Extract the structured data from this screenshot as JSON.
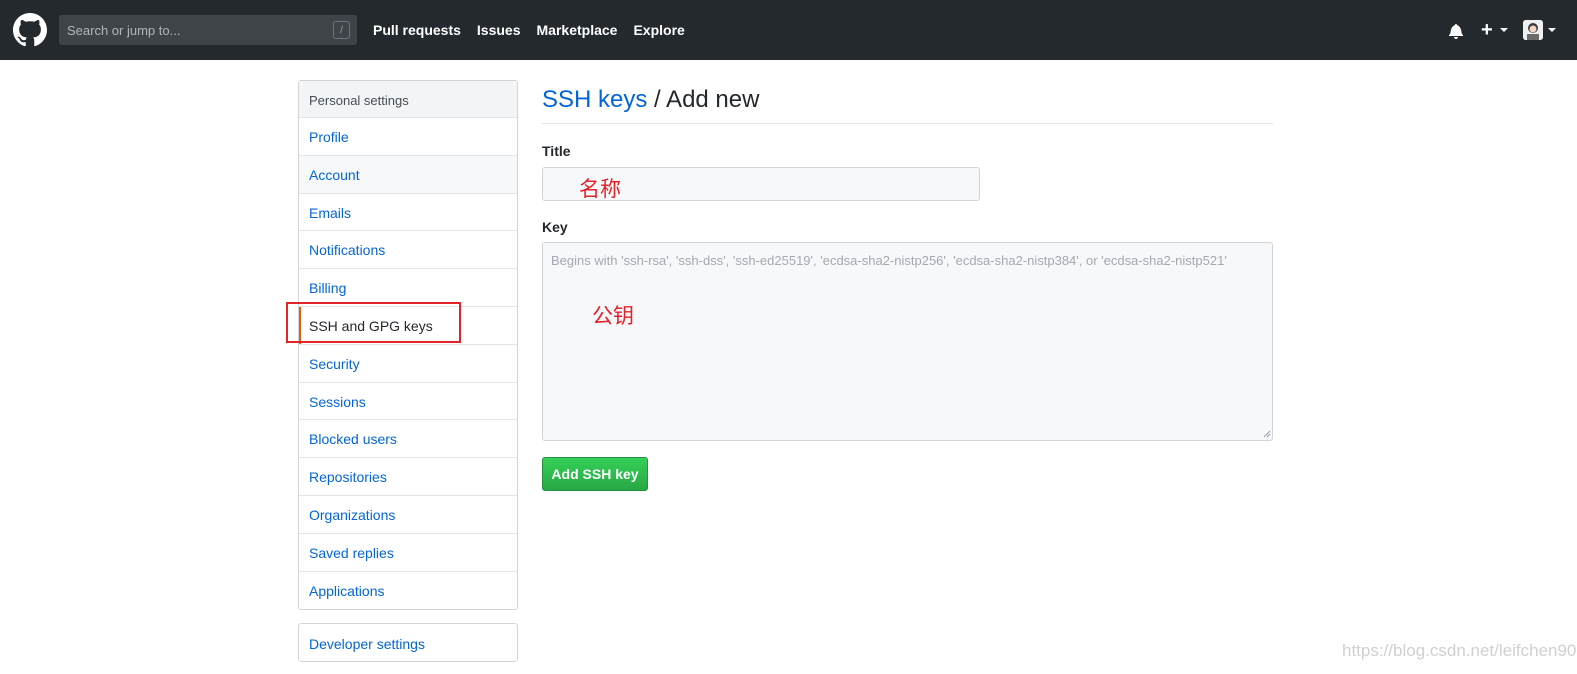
{
  "header": {
    "search_placeholder": "Search or jump to...",
    "search_shortcut": "/",
    "nav": [
      "Pull requests",
      "Issues",
      "Marketplace",
      "Explore"
    ],
    "plus_symbol": "+",
    "icons": [
      "github-logo-icon",
      "bell-icon",
      "plus-icon",
      "avatar"
    ]
  },
  "sidebar": {
    "heading": "Personal settings",
    "items": [
      {
        "label": "Profile"
      },
      {
        "label": "Account"
      },
      {
        "label": "Emails"
      },
      {
        "label": "Notifications"
      },
      {
        "label": "Billing"
      },
      {
        "label": "SSH and GPG keys",
        "selected": true
      },
      {
        "label": "Security"
      },
      {
        "label": "Sessions"
      },
      {
        "label": "Blocked users"
      },
      {
        "label": "Repositories"
      },
      {
        "label": "Organizations"
      },
      {
        "label": "Saved replies"
      },
      {
        "label": "Applications"
      }
    ],
    "developer_settings": "Developer settings"
  },
  "main": {
    "heading_link": "SSH keys",
    "heading_rest": " / Add new",
    "title_label": "Title",
    "title_annotation": "名称",
    "key_label": "Key",
    "key_placeholder": "Begins with 'ssh-rsa', 'ssh-dss', 'ssh-ed25519', 'ecdsa-sha2-nistp256', 'ecdsa-sha2-nistp384', or 'ecdsa-sha2-nistp521'",
    "key_annotation": "公钥",
    "add_button": "Add SSH key"
  },
  "watermark": "https://blog.csdn.net/leifchen90",
  "colors": {
    "header_bg": "#24292e",
    "link": "#0366d6",
    "selected_accent": "#e36209",
    "annotation_red": "#e2232a",
    "button_green": "#28a745"
  }
}
